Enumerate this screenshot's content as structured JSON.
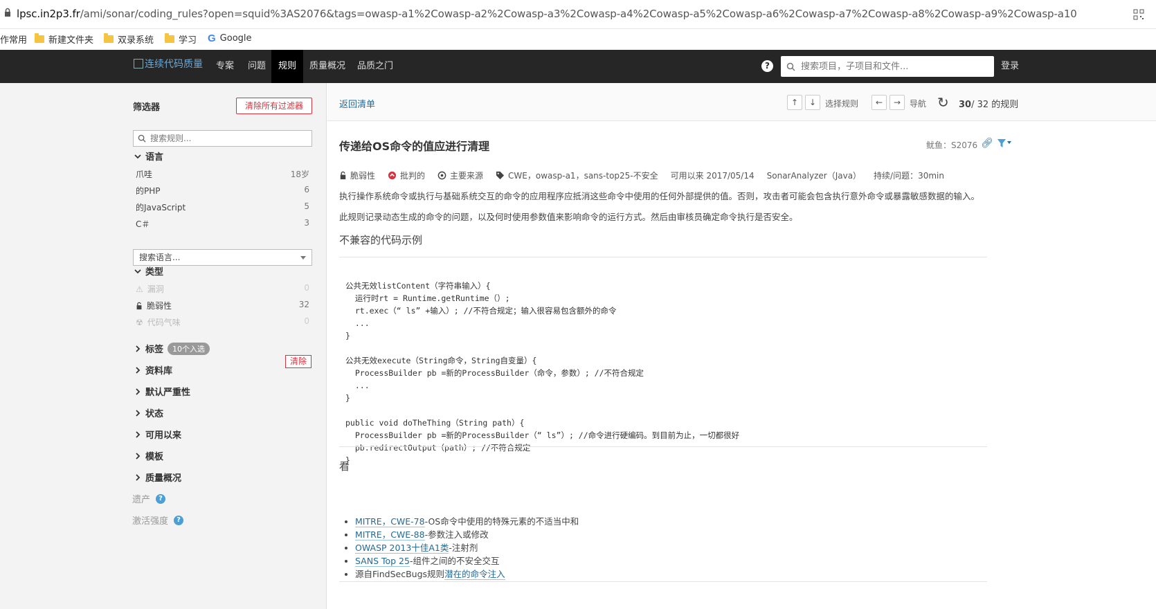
{
  "browser": {
    "url_host": "lpsc.in2p3.fr",
    "url_rest": "/ami/sonar/coding_rules?open=squid%3AS2076&tags=owasp-a1%2Cowasp-a2%2Cowasp-a3%2Cowasp-a4%2Cowasp-a5%2Cowasp-a6%2Cowasp-a7%2Cowasp-a8%2Cowasp-a9%2Cowasp-a10",
    "bookmarks": [
      "作常用",
      "新建文件夹",
      "双录系统",
      "学习",
      "Google"
    ]
  },
  "nav": {
    "logo_alt": "连续代码质量",
    "items": [
      "专案",
      "问题",
      "规则",
      "质量概况",
      "品质之门"
    ],
    "active_index": 2,
    "help": "?",
    "search_placeholder": "搜索项目，子项目和文件...",
    "login": "登录"
  },
  "sidebar": {
    "title": "筛选器",
    "clear_all": "清除所有过滤器",
    "search_placeholder": "搜索规则...",
    "language": {
      "label": "语言",
      "items": [
        {
          "name": "爪哇",
          "count": "18岁"
        },
        {
          "name": "的PHP",
          "count": "6"
        },
        {
          "name": "的JavaScript",
          "count": "5"
        },
        {
          "name": "C＃",
          "count": "3"
        }
      ],
      "search_placeholder": "搜索语言..."
    },
    "type": {
      "label": "类型",
      "items": [
        {
          "name": "漏洞",
          "count": "0"
        },
        {
          "name": "脆弱性",
          "count": "32"
        },
        {
          "name": "代码气味",
          "count": "0"
        }
      ]
    },
    "tags": {
      "label": "标签",
      "badge": "10个入选",
      "clear": "清除"
    },
    "collapsed": [
      "资料库",
      "默认严重性",
      "状态",
      "可用以来",
      "模板",
      "质量概况"
    ],
    "dimmed": [
      "遗产",
      "激活强度"
    ]
  },
  "main": {
    "back": "返回清单",
    "select_rule": "选择规则",
    "navigate": "导航",
    "counter_current": "30",
    "counter_rest": "/ 32 的规则",
    "title": "传递给OS命令的值应进行清理",
    "key": "鱿鱼：S2076",
    "meta": {
      "type": "脆弱性",
      "severity": "批判的",
      "source": "主要来源",
      "tags": "CWE，owasp-a1，sans-top25-不安全",
      "available": "可用以来 2017/05/14",
      "repo": "SonarAnalyzer（Java）",
      "debt": "持续/问题：30min"
    },
    "desc1": "执行操作系统命令或执行与基础系统交互的命令的应用程序应抵消这些命令中使用的任何外部提供的值。否则，攻击者可能会包含执行意外命令或暴露敏感数据的输入。",
    "desc2": "此规则记录动态生成的命令的问题，以及何时使用参数值来影响命令的运行方式。然后由审核员确定命令执行是否安全。",
    "noncompliant_heading": "不兼容的代码示例",
    "code": "公共无效listContent（字符串输入）{\n  运行时rt = Runtime.getRuntime（）;\n  rt.exec（“ ls” +输入）; //不符合规定；输入很容易包含额外的命令\n  ...\n}\n\n公共无效execute（String命令，String自变量）{\n  ProcessBuilder pb =新的ProcessBuilder（命令，参数）; //不符合规定\n  ...\n}\n\npublic void doTheThing（String path）{\n  ProcessBuilder pb =新的ProcessBuilder（“ ls”）; //命令进行硬编码。到目前为止，一切都很好\n  pb.redirectOutput（path）; //不符合规定\n}",
    "see_heading": "看",
    "see_also": [
      {
        "link": "MITRE，CWE-78",
        "text": "-OS命令中使用的特殊元素的不适当中和"
      },
      {
        "link": "MITRE，CWE-88",
        "text": "-参数注入或修改"
      },
      {
        "link": "OWASP 2013十佳A1类",
        "text": "-注射剂"
      },
      {
        "link": "SANS Top 25",
        "text": "-组件之间的不安全交互"
      },
      {
        "prefix": "源自FindSecBugs规则",
        "link": "潜在的命令注入",
        "text": ""
      }
    ]
  },
  "colors": {
    "nav_bg": "#262626",
    "accent": "#236a97",
    "danger": "#d4333f"
  }
}
